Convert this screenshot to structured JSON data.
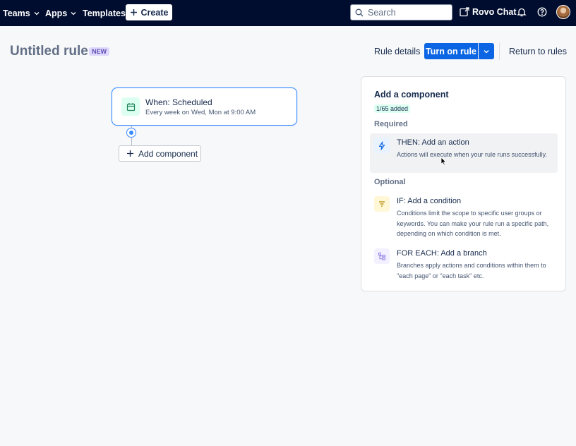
{
  "nav": {
    "teams": "Teams",
    "apps": "Apps",
    "templates": "Templates",
    "create": "Create",
    "search_placeholder": "Search",
    "rovo_chat": "Rovo Chat"
  },
  "header": {
    "title": "Untitled rule",
    "badge": "NEW",
    "rule_details": "Rule details",
    "turn_on": "Turn on rule",
    "return": "Return to rules"
  },
  "canvas": {
    "trigger": {
      "title": "When: Scheduled",
      "subtitle": "Every week on Wed, Mon at 9:00 AM",
      "icon": "calendar-icon"
    },
    "add_component": "Add component"
  },
  "panel": {
    "title": "Add a component",
    "count": "1/65 added",
    "required_label": "Required",
    "optional_label": "Optional",
    "required": [
      {
        "title": "THEN: Add an action",
        "description": "Actions will execute when your rule runs successfully.",
        "icon": "lightning-icon"
      }
    ],
    "optional": [
      {
        "title": "IF: Add a condition",
        "description": "Conditions limit the scope to specific user groups or keywords. You can make your rule run a specific path, depending on which condition is met.",
        "icon": "filter-icon"
      },
      {
        "title": "FOR EACH: Add a branch",
        "description": "Branches apply actions and conditions within them to \"each page\" or \"each task\" etc.",
        "icon": "branch-icon"
      }
    ]
  },
  "colors": {
    "nav_bg": "#000d2e",
    "primary": "#0c66e4",
    "selected_border": "#388bff",
    "new_badge_bg": "#dfd8fd",
    "trigger_icon_bg": "#dcfff1",
    "action_icon_bg": "#e9f2ff",
    "condition_icon_bg": "#fff7d6",
    "branch_icon_bg": "#f3f0ff"
  }
}
